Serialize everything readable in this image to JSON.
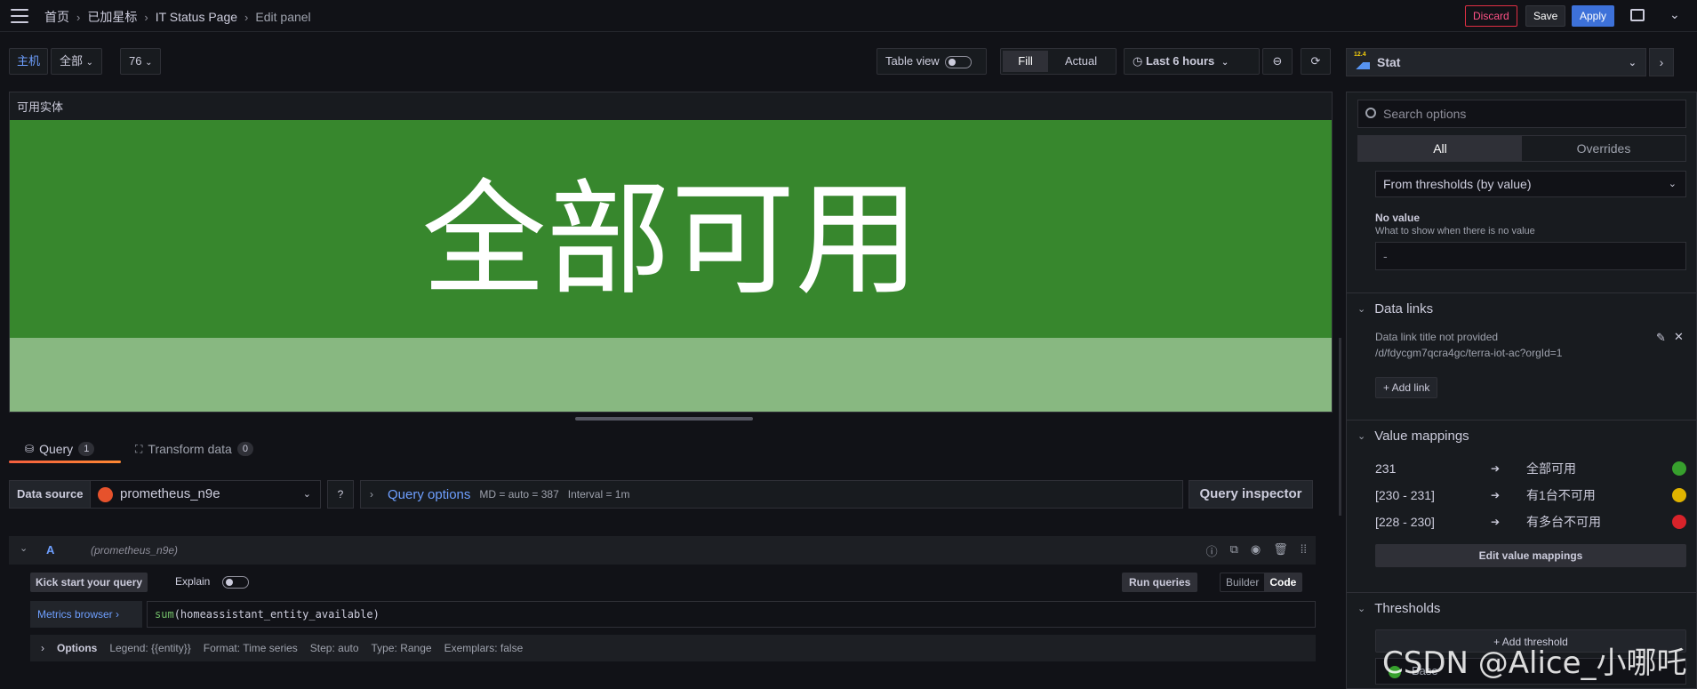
{
  "breadcrumbs": [
    "首页",
    "已加星标",
    "IT Status Page",
    "Edit panel"
  ],
  "topbar": {
    "discard": "Discard",
    "save": "Save",
    "apply": "Apply"
  },
  "variables": {
    "host_label": "主机",
    "host_value": "全部",
    "num_value": "76"
  },
  "toolbar": {
    "table_view": "Table view",
    "fill": "Fill",
    "actual": "Actual",
    "time_range": "Last 6 hours"
  },
  "panel": {
    "title": "可用实体",
    "value": "全部可用",
    "colors": {
      "top": "#37872d",
      "bottom": "#88b881"
    }
  },
  "tabs": {
    "query": "Query",
    "query_count": "1",
    "transform": "Transform data",
    "transform_count": "0"
  },
  "datasource": {
    "label": "Data source",
    "name": "prometheus_n9e",
    "query_options": "Query options",
    "md": "MD = auto = 387",
    "interval": "Interval = 1m",
    "inspector": "Query inspector"
  },
  "query": {
    "ref": "A",
    "source": "(prometheus_n9e)",
    "kick_start": "Kick start your query",
    "explain": "Explain",
    "run": "Run queries",
    "builder": "Builder",
    "code": "Code",
    "metrics_browser": "Metrics browser ›",
    "expr_fn": "sum",
    "expr_rest": "(homeassistant_entity_available)",
    "options_label": "Options",
    "legend": "Legend: {{entity}}",
    "format": "Format: Time series",
    "step": "Step: auto",
    "type": "Type: Range",
    "exemplars": "Exemplars: false"
  },
  "right": {
    "visualization": "Stat",
    "search_placeholder": "Search options",
    "all": "All",
    "overrides": "Overrides",
    "color_mode": "From thresholds (by value)",
    "no_value_title": "No value",
    "no_value_desc": "What to show when there is no value",
    "no_value_input": "-",
    "data_links_title": "Data links",
    "data_link_name": "Data link title not provided",
    "data_link_url": "/d/fdycgm7qcra4gc/terra-iot-ac?orgId=1",
    "add_link": "+ Add link",
    "value_mappings_title": "Value mappings",
    "mappings": [
      {
        "key": "231",
        "text": "全部可用",
        "color": "#37a02d"
      },
      {
        "key": "[230 - 231]",
        "text": "有1台不可用",
        "color": "#e0b400"
      },
      {
        "key": "[228 - 230]",
        "text": "有多台不可用",
        "color": "#d8232a"
      }
    ],
    "edit_mappings": "Edit value mappings",
    "thresholds_title": "Thresholds",
    "add_threshold": "+ Add threshold",
    "base": "Base"
  },
  "watermark": "CSDN @Alice_小哪吒"
}
